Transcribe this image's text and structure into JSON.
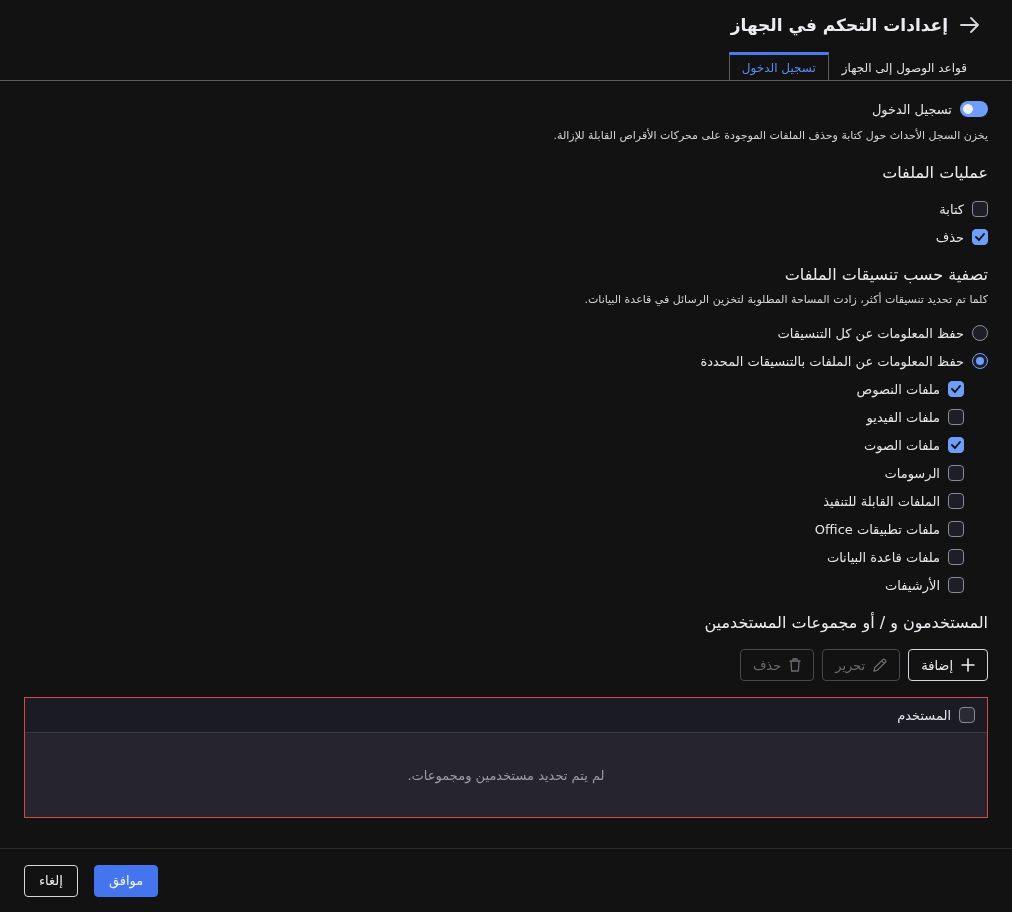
{
  "header": {
    "title": "إعدادات التحكم في الجهاز"
  },
  "tabs": [
    {
      "label": "قواعد الوصول إلى الجهاز",
      "selected": false
    },
    {
      "label": "تسجيل الدخول",
      "selected": true
    }
  ],
  "logging": {
    "label": "تسجيل الدخول",
    "on": true,
    "description": "يخزن السجل الأحداث حول كتابة وحذف الملفات الموجودة على محركات الأقراص القابلة للإزالة."
  },
  "file_operations": {
    "heading": "عمليات الملفات",
    "options": [
      {
        "label": "كتابة",
        "checked": false
      },
      {
        "label": "حذف",
        "checked": true
      }
    ]
  },
  "format_filter": {
    "heading": "تصفية حسب تنسيقات الملفات",
    "description": "كلما تم تحديد تنسيقات أكثر، زادت المساحة المطلوبة لتخزين الرسائل في قاعدة البيانات.",
    "modes": [
      {
        "label": "حفظ المعلومات عن كل التنسيقات",
        "selected": false
      },
      {
        "label": "حفظ المعلومات عن الملفات بالتنسيقات المحددة",
        "selected": true,
        "children": [
          {
            "label": "ملفات النصوص",
            "checked": true
          },
          {
            "label": "ملفات الفيديو",
            "checked": false
          },
          {
            "label": "ملفات الصوت",
            "checked": true
          },
          {
            "label": "الرسومات",
            "checked": false
          },
          {
            "label": "الملفات القابلة للتنفيذ",
            "checked": false
          },
          {
            "label": "ملفات تطبيقات Office",
            "checked": false
          },
          {
            "label": "ملفات قاعدة البيانات",
            "checked": false
          },
          {
            "label": "الأرشيفات",
            "checked": false
          }
        ]
      }
    ]
  },
  "users": {
    "heading": "المستخدمون و / أو مجموعات المستخدمين",
    "toolbar": [
      {
        "kind": "add",
        "label": "إضافة",
        "disabled": false
      },
      {
        "kind": "edit",
        "label": "تحرير",
        "disabled": true
      },
      {
        "kind": "delete",
        "label": "حذف",
        "disabled": true
      }
    ],
    "table": {
      "invalid": true,
      "select_all_checked": false,
      "columns": [
        {
          "label": "المستخدم"
        }
      ],
      "empty_message": "لم يتم تحديد مستخدمين ومجموعات."
    }
  },
  "footer": {
    "buttons": [
      {
        "kind": "confirm",
        "label": "موافق"
      },
      {
        "kind": "cancel",
        "label": "إلغاء"
      }
    ]
  }
}
